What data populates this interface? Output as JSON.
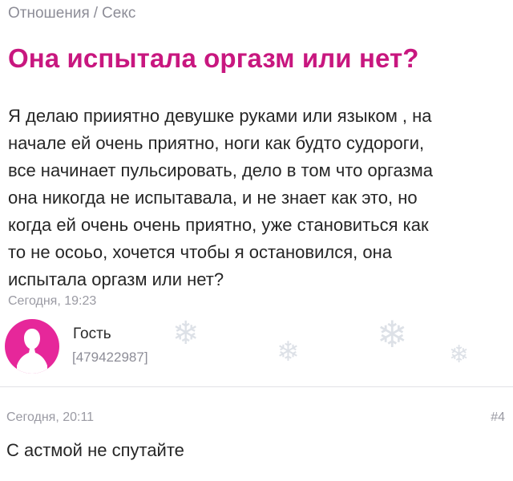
{
  "breadcrumb": {
    "section": "Отношения",
    "separator": "/",
    "category": "Секс"
  },
  "question": {
    "title": "Она испытала оргазм или нет?",
    "body_lines": [
      "Я делаю прииятно девушке руками или языком , на",
      "начале ей очень приятно, ноги как будто судороги,",
      "все начинает пульсировать, дело в том что оргазма",
      "она никогда не испытавала, и не знает как это, но",
      "когда ей очень очень приятно, уже становиться как",
      "то не осоьо, хочется чтобы я остановился, она",
      "испытала оргазм или нет?"
    ],
    "timestamp": "Сегодня, 19:23"
  },
  "author": {
    "name": "Гость",
    "id": "[479422987]",
    "avatar_icon": "user-silhouette-icon",
    "avatar_color": "#e6279a"
  },
  "answer": {
    "timestamp": "Сегодня, 20:11",
    "number": "#4",
    "text": "С астмой не спутайте"
  },
  "colors": {
    "title": "#c8177f",
    "muted": "#8d8d97",
    "text": "#262626"
  }
}
